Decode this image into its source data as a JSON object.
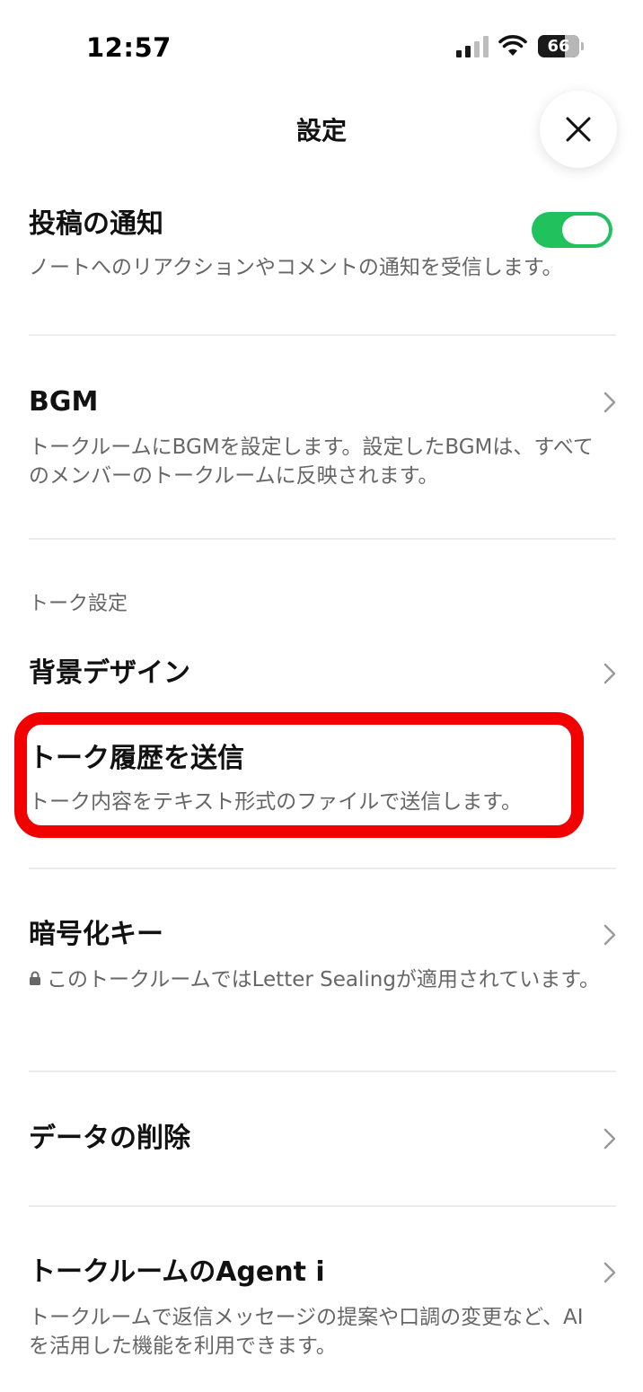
{
  "status_bar": {
    "time": "12:57",
    "battery": "66",
    "battery_level": 0.66
  },
  "header": {
    "title": "設定"
  },
  "rows": {
    "post_notification": {
      "title": "投稿の通知",
      "description": "ノートへのリアクションやコメントの通知を受信します。",
      "toggle_on": true
    },
    "bgm": {
      "title": "BGM",
      "description": "トークルームにBGMを設定します。設定したBGMは、すべてのメンバーのトークルームに反映されます。"
    },
    "section_label": "トーク設定",
    "background_design": {
      "title": "背景デザイン"
    },
    "send_history": {
      "title": "トーク履歴を送信",
      "description": "トーク内容をテキスト形式のファイルで送信します。"
    },
    "encryption_key": {
      "title": "暗号化キー",
      "description": "このトークルームではLetter Sealingが適用されています。"
    },
    "delete_data": {
      "title": "データの削除"
    },
    "agent_i": {
      "title": "トークルームのAgent i",
      "description": "トークルームで返信メッセージの提案や口調の変更など、AIを活用した機能を利用できます。"
    }
  },
  "colors": {
    "toggle_on": "#21c25e",
    "highlight": "#f20000",
    "secondary_text": "#666666"
  },
  "icons": [
    "signal-icon",
    "wifi-icon",
    "battery-icon",
    "close-icon",
    "chevron-right-icon",
    "lock-icon"
  ]
}
